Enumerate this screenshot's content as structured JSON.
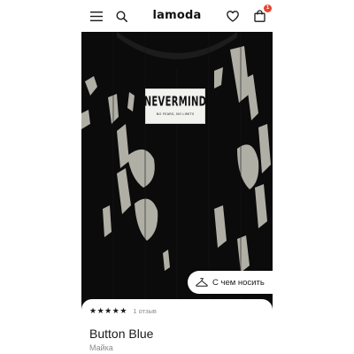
{
  "header": {
    "logo": "lamoda",
    "cart_count": "1",
    "icons": [
      "hamburger-menu-icon",
      "search-icon",
      "heart-icon",
      "shopping-bag-icon"
    ],
    "accent_color": "#e8442f"
  },
  "product_image": {
    "label_brand": "NEVERMIND",
    "label_tagline": "NO FEARS, NO LIMITS"
  },
  "outfit_button": {
    "label": "С чем носить",
    "icon": "hanger-icon"
  },
  "product": {
    "rating": 5,
    "rating_max": 5,
    "reviews": "1 отзыв",
    "title": "Button Blue",
    "subtitle": "Майка"
  }
}
